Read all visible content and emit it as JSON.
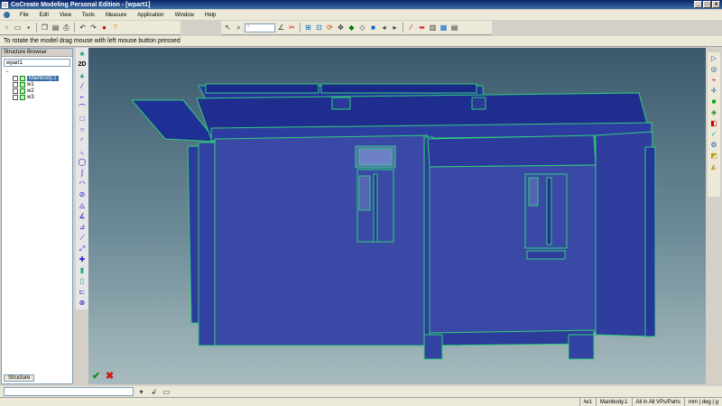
{
  "window": {
    "title": "CoCreate Modeling Personal Edition - [wpart1]",
    "controls": [
      "_",
      "□",
      "x"
    ]
  },
  "menu": [
    "File",
    "Edit",
    "View",
    "Tools",
    "Measure",
    "Application",
    "Window",
    "Help"
  ],
  "toolbar": {
    "zoom_combo": "°"
  },
  "hint": "To rotate the model drag mouse with left mouse button pressed",
  "structure": {
    "panel_title": "Structure Browser",
    "combo_value": "wpart1",
    "root": "",
    "items": [
      {
        "label": "Mainbody.1",
        "selected": true
      },
      {
        "label": "w1",
        "selected": false
      },
      {
        "label": "w2",
        "selected": false
      },
      {
        "label": "w3",
        "selected": false
      }
    ],
    "tab": "Structure"
  },
  "left_tools_label": "2D",
  "status": {
    "cells": [
      "/w1",
      "Mainbody.1",
      "All in All VPs/Parts",
      "mm | deg | g"
    ]
  },
  "colors": {
    "model_fill": "#3a49a5",
    "model_edge": "#2fd07a",
    "viewport_top": "#3b5a6e",
    "viewport_bottom": "#a8bcbf"
  }
}
